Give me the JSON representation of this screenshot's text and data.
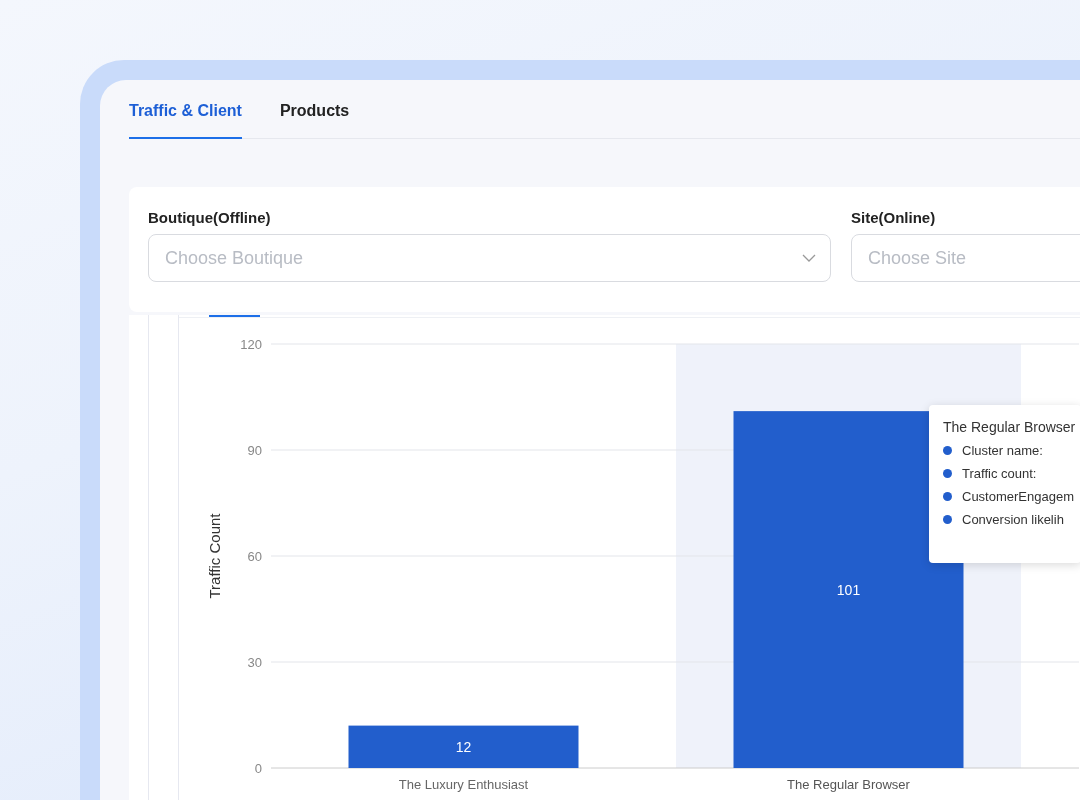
{
  "tabs": [
    {
      "label": "Traffic & Client",
      "selected": true
    },
    {
      "label": "Products",
      "selected": false
    }
  ],
  "filters": [
    {
      "label": "Boutique(Offline)",
      "placeholder": "Choose Boutique",
      "dropdown": true
    },
    {
      "label": "Site(Online)",
      "placeholder": "Choose Site"
    }
  ],
  "chart": {
    "chart_data": {
      "type": "bar",
      "ylabel": "Traffic Count",
      "categories": [
        "The Luxury Enthusiast",
        "The Regular Browser"
      ],
      "series": [
        {
          "color": "#225ecc",
          "values": [
            12,
            101
          ]
        }
      ],
      "ylim": [
        0,
        120
      ],
      "yticks": [
        0,
        30,
        60,
        90,
        120
      ],
      "grid": true,
      "data_labels": true
    },
    "hover": [
      {
        "selected": false
      },
      {
        "selected": true
      }
    ],
    "tooltip": {
      "title": "The Regular Browser",
      "items": [
        "Cluster name:",
        "Traffic count:",
        "CustomerEngagem",
        "Conversion likelih"
      ]
    }
  }
}
